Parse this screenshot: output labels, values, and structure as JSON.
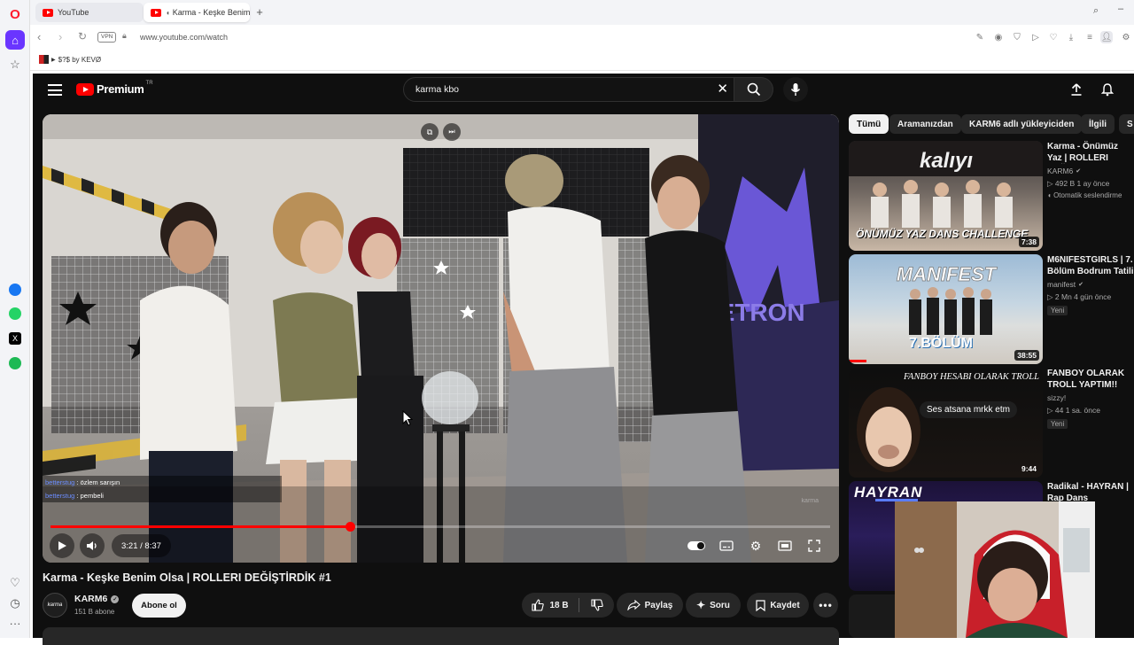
{
  "browser": {
    "tabs": [
      {
        "label": "YouTube",
        "active": false
      },
      {
        "label": "Karma - Keşke Benim",
        "active": true
      }
    ],
    "new_tab": "+",
    "vpn_badge": "VPN",
    "url": "www.youtube.com/watch",
    "bookmark_label": "$?$ by KEVØ"
  },
  "youtube": {
    "logo_text": "Premium",
    "region": "TR",
    "search_value": "karma kbo",
    "filters": [
      "Tümü",
      "Aramanızdan",
      "KARM6 adlı yükleyiciden",
      "İlgili",
      "S"
    ],
    "video": {
      "title": "Karma - Keşke Benim Olsa | ROLLERI DEĞİŞTİRDİK #1",
      "time": "3:21 / 8:37",
      "progress": 0.385,
      "scene_text": "METRON",
      "watermark": "karma"
    },
    "channel": {
      "name": "KARM6",
      "subs": "151 B abone",
      "avatar_text": "karma",
      "subscribe": "Abone ol"
    },
    "actions": {
      "likes": "18 B",
      "share": "Paylaş",
      "ask": "Soru",
      "save": "Kaydet"
    },
    "chat": [
      {
        "user": "betterstug",
        "message": ": özlem sarışın"
      },
      {
        "user": "betterstug",
        "message": ": pembeli"
      }
    ],
    "recommendations": [
      {
        "title": "Karma - Önümüz Yaz | ROLLERI DEĞİŞTİRDİK",
        "channel": "KARM6",
        "views": "▷ 492 B",
        "age": "1 ay önce",
        "badge": "Otomatik seslendirme",
        "duration": "7:38",
        "thumb_text": "ÖNÜMÜZ YAZ DANS CHALLENGE"
      },
      {
        "title": "M6NIFESTGIRLS | 7. Bölüm Bodrum Tatili",
        "channel": "manifest",
        "views": "▷ 2 Mn",
        "age": "4 gün önce",
        "badge": "Yeni",
        "duration": "38:55",
        "thumb_text": "7.BÖLÜM"
      },
      {
        "title": "FANBOY OLARAK TROLL YAPTIM!!",
        "channel": "sizzy!",
        "views": "▷ 44",
        "age": "1 sa. önce",
        "badge": "Yeni",
        "duration": "9:44",
        "thumb_text": "FANBOY HESABI OLARAK TROLL",
        "thumb_bubble": "Ses atsana mrkk etm"
      },
      {
        "title": "Radikal - HAYRAN | Rap Dans",
        "channel": "",
        "views": "",
        "age": "",
        "badge": "",
        "duration": "",
        "thumb_text": "HAYRAN"
      }
    ]
  },
  "colors": {
    "yt_red": "#ff0000",
    "yt_bg": "#0f0f0f",
    "chip": "#272727",
    "opera_red": "#ff1b2d",
    "opera_accent": "#6a35ff"
  }
}
